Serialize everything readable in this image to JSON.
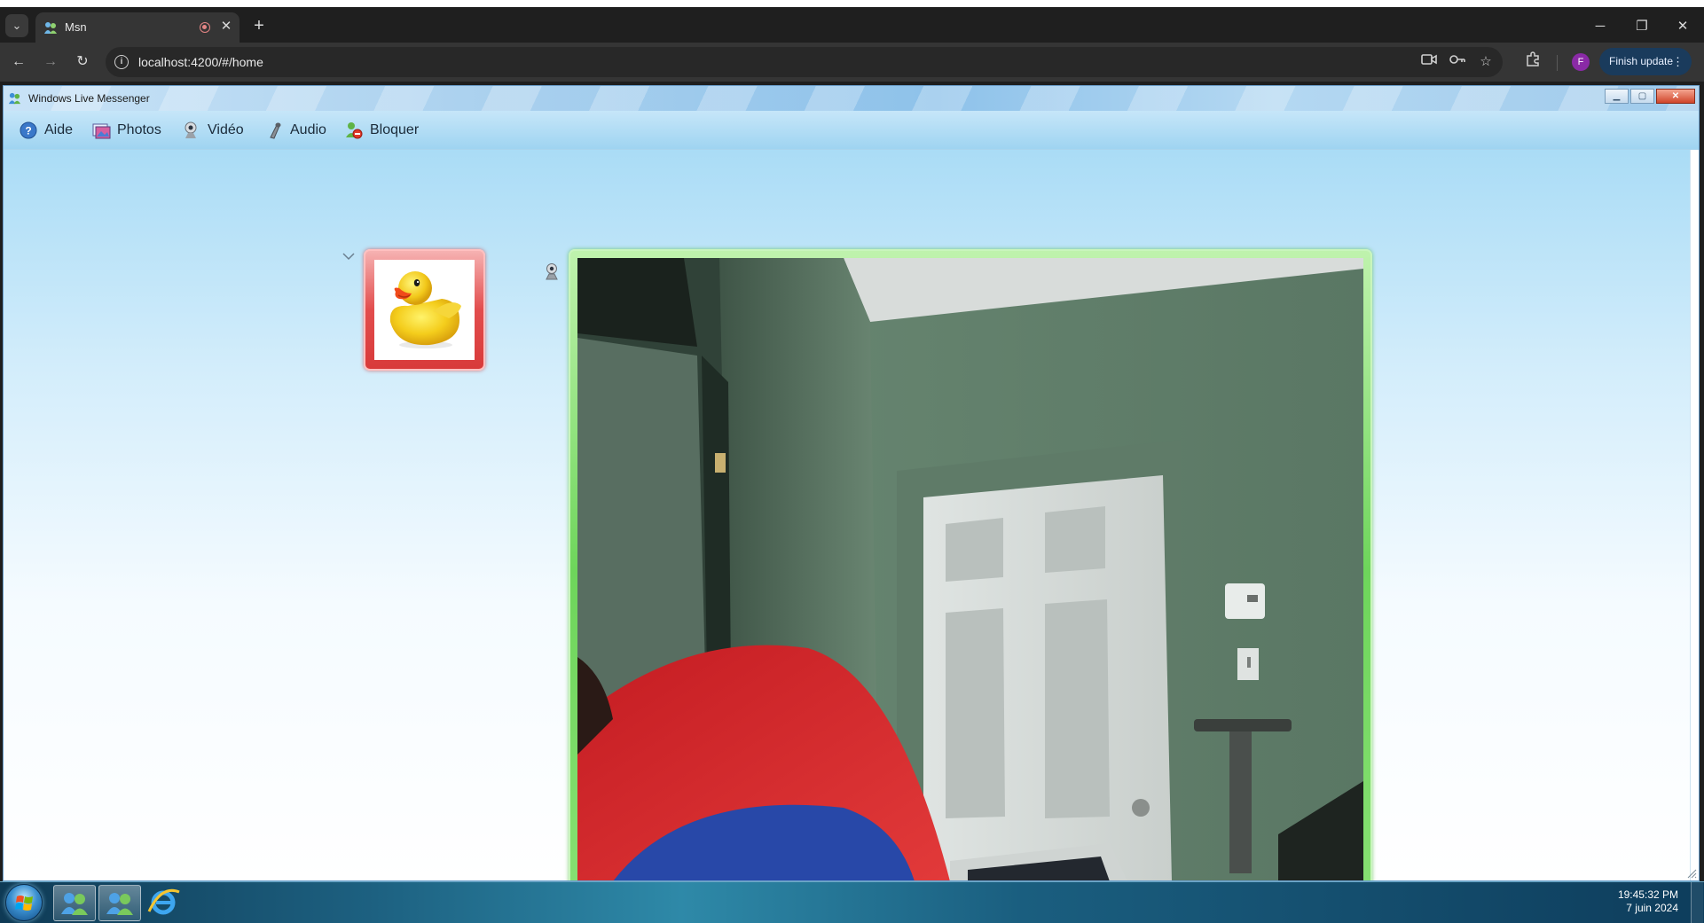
{
  "browser": {
    "tab": {
      "title": "Msn"
    },
    "window_buttons": {
      "minimize": "─",
      "restore": "❐",
      "close": "✕"
    },
    "new_tab": "+",
    "address": {
      "url": "localhost:4200/#/home"
    },
    "finish_update_label": "Finish update",
    "profile_initial": "F"
  },
  "app": {
    "title": "Windows Live Messenger",
    "menu": [
      {
        "label": "Aide",
        "icon": "help-icon"
      },
      {
        "label": "Photos",
        "icon": "photos-icon"
      },
      {
        "label": "Vidéo",
        "icon": "webcam-icon"
      },
      {
        "label": "Audio",
        "icon": "microphone-icon"
      },
      {
        "label": "Bloquer",
        "icon": "block-contact-icon"
      }
    ],
    "contact_avatar": "rubber-duck",
    "video_feed": "webcam-room-green-walls-white-door"
  },
  "taskbar": {
    "time": "19:45:32 PM",
    "date": "7 juin 2024",
    "pinned": [
      "messenger-icon",
      "messenger-icon",
      "internet-explorer-icon"
    ]
  },
  "colors": {
    "avatar_frame": "#e24d4d",
    "video_frame": "#6ed55b",
    "menubar": "#b5def5",
    "finish_update": "#1a3b5c"
  }
}
